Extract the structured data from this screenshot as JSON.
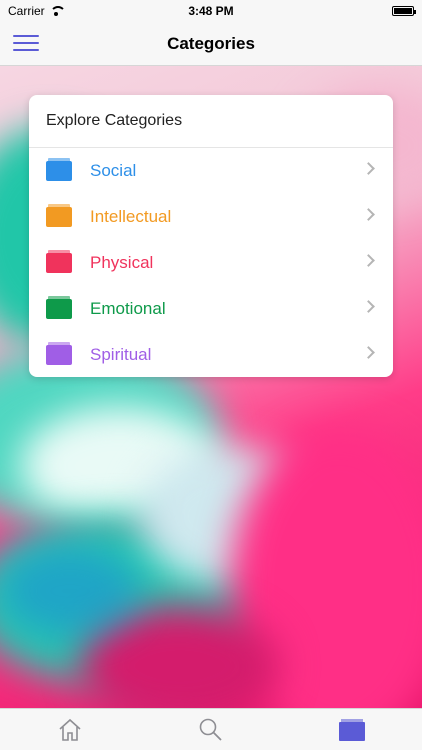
{
  "status_bar": {
    "carrier": "Carrier",
    "time": "3:48 PM"
  },
  "nav": {
    "title": "Categories",
    "menu_icon": "hamburger-menu-icon",
    "accent_color": "#5b5bd6"
  },
  "card": {
    "header": "Explore Categories",
    "items": [
      {
        "label": "Social",
        "color": "#2d8fe8",
        "icon": "folder-icon"
      },
      {
        "label": "Intellectual",
        "color": "#f29a22",
        "icon": "folder-icon"
      },
      {
        "label": "Physical",
        "color": "#f0335c",
        "icon": "folder-icon"
      },
      {
        "label": "Emotional",
        "color": "#0e9a4a",
        "icon": "folder-icon"
      },
      {
        "label": "Spiritual",
        "color": "#a05ee6",
        "icon": "folder-icon"
      }
    ]
  },
  "tab_bar": {
    "tabs": [
      {
        "icon": "home-icon",
        "active": false
      },
      {
        "icon": "search-icon",
        "active": false
      },
      {
        "icon": "folder-icon",
        "active": true
      }
    ],
    "inactive_color": "#8e8e93",
    "active_color": "#5b5bd6"
  }
}
